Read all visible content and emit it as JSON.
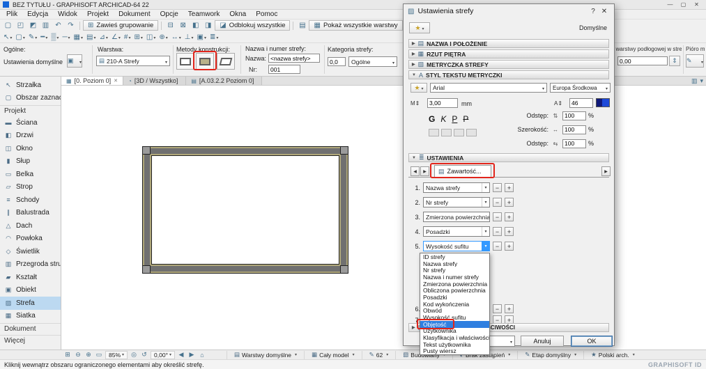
{
  "window": {
    "title": "BEZ TYTUŁU - GRAPHISOFT ARCHICAD-64 22",
    "minimize": "—",
    "maximize": "▢",
    "close": "✕"
  },
  "menubar": {
    "items": [
      {
        "label": "Plik"
      },
      {
        "label": "Edycja"
      },
      {
        "label": "Widok"
      },
      {
        "label": "Projekt"
      },
      {
        "label": "Dokument"
      },
      {
        "label": "Opcje"
      },
      {
        "label": "Teamwork"
      },
      {
        "label": "Okna"
      },
      {
        "label": "Pomoc"
      }
    ]
  },
  "toolbar1": {
    "icons_a": [
      {
        "g": "▢",
        "n": "new-icon"
      },
      {
        "g": "◰",
        "n": "open-icon"
      },
      {
        "g": "◩",
        "n": "save-icon"
      },
      {
        "g": "▥",
        "n": "print-icon"
      },
      {
        "g": "↶",
        "n": "undo-icon"
      },
      {
        "g": "↷",
        "n": "redo-icon"
      }
    ],
    "suspend": {
      "icon": "⊞",
      "label": "Zawieś grupowanie"
    },
    "icons_b": [
      {
        "g": "⊟",
        "n": "group-icon"
      },
      {
        "g": "⊠",
        "n": "ungroup-icon"
      },
      {
        "g": "◧",
        "n": "lock-icon"
      },
      {
        "g": "◨",
        "n": "unlock-icon"
      }
    ],
    "unlock": {
      "icon": "◪",
      "label": "Odblokuj wszystkie"
    },
    "icons_c": [
      {
        "g": "▤",
        "n": "layers-icon"
      }
    ],
    "show_layers": {
      "icon": "▦",
      "label": "Pokaż wszystkie warstwy"
    },
    "icons_d": [
      {
        "g": "⊡",
        "n": "options-icon"
      },
      {
        "g": "✎",
        "n": "edit-icon"
      },
      {
        "g": "⌂",
        "n": "home-icon"
      }
    ]
  },
  "toolbar2": {
    "icons": [
      {
        "g": "↖",
        "c": true,
        "n": "select-tool-icon"
      },
      {
        "g": "▢",
        "c": true,
        "n": "marquee-icon"
      },
      {
        "g": "✎",
        "c": true,
        "n": "pen-color-icon"
      },
      {
        "g": "━",
        "c": true,
        "n": "line-weight-icon"
      },
      {
        "g": "▒",
        "c": true,
        "n": "fill-icon"
      },
      {
        "g": "─",
        "c": true,
        "n": "line-type-icon"
      },
      {
        "g": "▦",
        "c": true,
        "n": "grid-icon"
      },
      {
        "g": "▤",
        "c": true,
        "n": "layer-combo-icon"
      },
      {
        "g": "⊿",
        "c": true,
        "n": "angle-icon"
      },
      {
        "g": "∠",
        "c": false,
        "n": "protractor-icon"
      },
      {
        "g": "#",
        "c": false,
        "n": "snap-grid-icon"
      },
      {
        "g": "⊞",
        "c": false,
        "n": "guide-lines-icon"
      },
      {
        "g": "◫",
        "c": false,
        "n": "split-icon"
      },
      {
        "g": "⊕",
        "c": true,
        "n": "snap-point-icon"
      },
      {
        "g": "↔",
        "c": false,
        "n": "stretch-icon"
      },
      {
        "g": "⊥",
        "c": false,
        "n": "perpendicular-icon"
      },
      {
        "g": "▣",
        "c": true,
        "n": "favorites-icon"
      },
      {
        "g": "≣",
        "c": true,
        "n": "more-tools-icon"
      }
    ]
  },
  "infobox": {
    "general_label": "Ogólne:",
    "default_settings": "Ustawienia domyślne",
    "layer_label": "Warstwa:",
    "layer_value": "210-A Strefy",
    "methods_label": "Metody konstrukcji:",
    "name_number_label": "Nazwa i numer strefy:",
    "name_label": "Nazwa:",
    "name_value": "<nazwa strefy>",
    "nr_label": "Nr:",
    "nr_value": "001",
    "category_label": "Kategoria strefy:",
    "category_code": "0,0",
    "category_value": "Ogólne",
    "height_label": "Wysokość warstwy podłogowej w strefie:",
    "height_value": "0,00",
    "pen_label": "Pióro miary..."
  },
  "tabs": {
    "items": [
      {
        "label": "[0. Poziom 0]",
        "icon": "▦",
        "active": true,
        "close": "✕"
      },
      {
        "label": "[3D / Wszystko]",
        "icon": "◔"
      },
      {
        "label": "[A.03.2.2 Poziom 0]",
        "icon": "▤"
      }
    ]
  },
  "toolbox": {
    "items": [
      {
        "label": "Strzałka",
        "icon": "↖"
      },
      {
        "label": "Obszar zaznacz...",
        "icon": "▢"
      },
      {
        "label": "Projekt",
        "section": true
      },
      {
        "label": "Ściana",
        "icon": "▬"
      },
      {
        "label": "Drzwi",
        "icon": "◧"
      },
      {
        "label": "Okno",
        "icon": "◫"
      },
      {
        "label": "Słup",
        "icon": "▮"
      },
      {
        "label": "Belka",
        "icon": "▭"
      },
      {
        "label": "Strop",
        "icon": "▱"
      },
      {
        "label": "Schody",
        "icon": "≡"
      },
      {
        "label": "Balustrada",
        "icon": "∥"
      },
      {
        "label": "Dach",
        "icon": "△"
      },
      {
        "label": "Powłoka",
        "icon": "◠"
      },
      {
        "label": "Świetlik",
        "icon": "◇"
      },
      {
        "label": "Przegroda struk...",
        "icon": "▥"
      },
      {
        "label": "Kształt",
        "icon": "▰"
      },
      {
        "label": "Obiekt",
        "icon": "▣"
      },
      {
        "label": "Strefa",
        "icon": "▨",
        "selected": true
      },
      {
        "label": "Siatka",
        "icon": "▦"
      },
      {
        "label": "Dokument",
        "section": true
      },
      {
        "label": "Więcej",
        "section": true
      }
    ]
  },
  "dialog": {
    "title": "Ustawienia strefy",
    "zone_icon": "▨",
    "help": "?",
    "close": "✕",
    "favorite_star": "★",
    "default_label": "Domyślne",
    "sec_name": {
      "label": "NAZWA I POŁOŻENIE",
      "icon": "▤"
    },
    "sec_plan": {
      "label": "RZUT PIĘTRA",
      "icon": "▦"
    },
    "sec_stamp": {
      "label": "METRYCZKA STREFY",
      "icon": "▨"
    },
    "sec_text": {
      "label": "STYL TEKSTU METRYCZKI",
      "icon": "A"
    },
    "sec_settings": {
      "label": "USTAWIENIA",
      "icon": "≣"
    },
    "sec_class": {
      "label": "KLASYFIKACJA I WŁAŚCIWOŚCI",
      "icon": "▤"
    },
    "text_style": {
      "font": "Arial",
      "encoding": "Europa Środkowa",
      "size_icon": "M⇕",
      "size": "3,00",
      "unit": "mm",
      "height_icon": "A⇕",
      "height": "46",
      "bold": "G",
      "italic": "K",
      "underline": "P",
      "strike": "P",
      "adjust_rows": [
        {
          "label": "Odstęp:",
          "icon": "⇅",
          "value": "100",
          "unit": "%"
        },
        {
          "label": "Szerokość:",
          "icon": "↔",
          "value": "100",
          "unit": "%"
        },
        {
          "label": "Odstęp:",
          "icon": "⇆",
          "value": "100",
          "unit": "%"
        }
      ]
    },
    "nav_left": "◀",
    "nav_right": "▶",
    "content_tab": {
      "icon": "▤",
      "label": "Zawartość..."
    },
    "stamp_rows": [
      {
        "num": "1.",
        "value": "Nazwa strefy"
      },
      {
        "num": "2.",
        "value": "Nr strefy"
      },
      {
        "num": "3.",
        "value": "Zmierzona powierzchnia"
      },
      {
        "num": "4.",
        "value": "Posadzki"
      },
      {
        "num": "5.",
        "value": "Wysokość sufitu",
        "open": true
      }
    ],
    "hidden_rows": [
      {
        "num": "6.",
        "value": ""
      },
      {
        "num": "7.",
        "value": ""
      }
    ],
    "minus": "−",
    "plus": "+",
    "dropdown": {
      "items": [
        {
          "label": "ID strefy"
        },
        {
          "label": "Nazwa strefy"
        },
        {
          "label": "Nr strefy"
        },
        {
          "label": "Nazwa i numer strefy"
        },
        {
          "label": "Zmierzona powierzchnia"
        },
        {
          "label": "Obliczona powierzchnia"
        },
        {
          "label": "Posadzki"
        },
        {
          "label": "Kod wykończenia"
        },
        {
          "label": "Obwód"
        },
        {
          "label": "Wysokość sufitu"
        },
        {
          "label": "Objętość",
          "selected": true
        },
        {
          "label": "Użytkownika"
        },
        {
          "label": "Klasyfikacja i właściwości"
        },
        {
          "label": "Tekst użytkownika"
        },
        {
          "label": "Pusty wiersz"
        }
      ]
    },
    "cancel": "Anuluj",
    "ok": "OK"
  },
  "statusbar": {
    "nav_icons": [
      {
        "g": "⊞",
        "n": "pan-icon"
      },
      {
        "g": "⊖",
        "n": "zoom-out-icon"
      },
      {
        "g": "⊕",
        "n": "zoom-in-icon"
      },
      {
        "g": "▭",
        "n": "zoom-window-icon"
      }
    ],
    "zoom": "85%",
    "mid_icons": [
      {
        "g": "◎",
        "n": "fit-view-icon"
      },
      {
        "g": "↺",
        "n": "rotate-view-icon"
      }
    ],
    "angle": "0,00°",
    "nav2_icons": [
      {
        "g": "◀",
        "n": "previous-view-icon"
      },
      {
        "g": "▶",
        "n": "next-view-icon"
      },
      {
        "g": "⌂",
        "n": "home-view-icon"
      }
    ],
    "quick": [
      {
        "icon": "▤",
        "label": "Warstwy domyślne"
      },
      {
        "icon": "▦",
        "label": "Cały model"
      },
      {
        "icon": "✎",
        "label": "62"
      },
      {
        "icon": "▧",
        "label": "Budowlany"
      },
      {
        "icon": "◐",
        "label": "Brak zastąpień"
      },
      {
        "icon": "✎",
        "label": "Etap domyślny"
      },
      {
        "icon": "★",
        "label": "Polski arch."
      }
    ]
  },
  "hintbar": {
    "text": "Kliknij wewnątrz obszaru ograniczonego elementami aby określić strefę.",
    "brand": "GRAPHISOFT ID"
  }
}
